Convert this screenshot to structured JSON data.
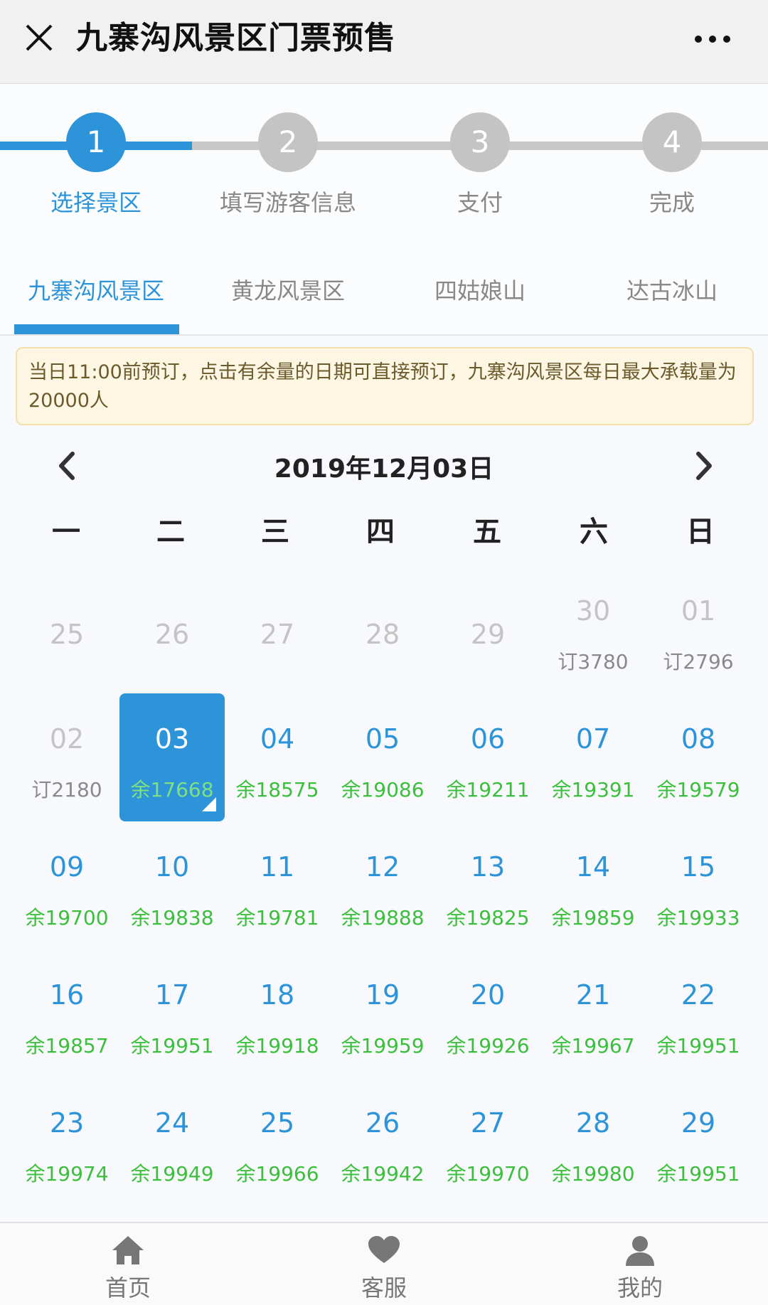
{
  "titlebar": {
    "title": "九寨沟风景区门票预售",
    "close_icon": "close-icon",
    "more_icon": "more-icon"
  },
  "steps": [
    {
      "num": "1",
      "label": "选择景区",
      "active": true
    },
    {
      "num": "2",
      "label": "填写游客信息",
      "active": false
    },
    {
      "num": "3",
      "label": "支付",
      "active": false
    },
    {
      "num": "4",
      "label": "完成",
      "active": false
    }
  ],
  "tabs": [
    "九寨沟风景区",
    "黄龙风景区",
    "四姑娘山",
    "达古冰山"
  ],
  "notice": "当日11:00前预订，点击有余量的日期可直接预订，九寨沟风景区每日最大承载量为20000人",
  "calendar": {
    "month_label": "2019年12月03日",
    "weekdays": [
      "一",
      "二",
      "三",
      "四",
      "五",
      "六",
      "日"
    ],
    "rows": [
      [
        {
          "num": "25",
          "sub": "",
          "state": "faded"
        },
        {
          "num": "26",
          "sub": "",
          "state": "faded"
        },
        {
          "num": "27",
          "sub": "",
          "state": "faded"
        },
        {
          "num": "28",
          "sub": "",
          "state": "faded"
        },
        {
          "num": "29",
          "sub": "",
          "state": "faded"
        },
        {
          "num": "30",
          "sub": "订3780",
          "state": "past"
        },
        {
          "num": "01",
          "sub": "订2796",
          "state": "past"
        }
      ],
      [
        {
          "num": "02",
          "sub": "订2180",
          "state": "past"
        },
        {
          "num": "03",
          "sub": "余17668",
          "state": "selected"
        },
        {
          "num": "04",
          "sub": "余18575",
          "state": "available"
        },
        {
          "num": "05",
          "sub": "余19086",
          "state": "available"
        },
        {
          "num": "06",
          "sub": "余19211",
          "state": "available"
        },
        {
          "num": "07",
          "sub": "余19391",
          "state": "available"
        },
        {
          "num": "08",
          "sub": "余19579",
          "state": "available"
        }
      ],
      [
        {
          "num": "09",
          "sub": "余19700",
          "state": "available"
        },
        {
          "num": "10",
          "sub": "余19838",
          "state": "available"
        },
        {
          "num": "11",
          "sub": "余19781",
          "state": "available"
        },
        {
          "num": "12",
          "sub": "余19888",
          "state": "available"
        },
        {
          "num": "13",
          "sub": "余19825",
          "state": "available"
        },
        {
          "num": "14",
          "sub": "余19859",
          "state": "available"
        },
        {
          "num": "15",
          "sub": "余19933",
          "state": "available"
        }
      ],
      [
        {
          "num": "16",
          "sub": "余19857",
          "state": "available"
        },
        {
          "num": "17",
          "sub": "余19951",
          "state": "available"
        },
        {
          "num": "18",
          "sub": "余19918",
          "state": "available"
        },
        {
          "num": "19",
          "sub": "余19959",
          "state": "available"
        },
        {
          "num": "20",
          "sub": "余19926",
          "state": "available"
        },
        {
          "num": "21",
          "sub": "余19967",
          "state": "available"
        },
        {
          "num": "22",
          "sub": "余19951",
          "state": "available"
        }
      ],
      [
        {
          "num": "23",
          "sub": "余19974",
          "state": "available"
        },
        {
          "num": "24",
          "sub": "余19949",
          "state": "available"
        },
        {
          "num": "25",
          "sub": "余19966",
          "state": "available"
        },
        {
          "num": "26",
          "sub": "余19942",
          "state": "available"
        },
        {
          "num": "27",
          "sub": "余19970",
          "state": "available"
        },
        {
          "num": "28",
          "sub": "余19980",
          "state": "available"
        },
        {
          "num": "29",
          "sub": "余19951",
          "state": "available"
        }
      ]
    ]
  },
  "bottom_nav": [
    {
      "label": "首页",
      "icon": "home-icon"
    },
    {
      "label": "客服",
      "icon": "heart-icon"
    },
    {
      "label": "我的",
      "icon": "user-icon"
    }
  ],
  "colors": {
    "accent": "#2d94d9",
    "available": "#3cbf3c",
    "inactive": "#c4c4c4"
  }
}
